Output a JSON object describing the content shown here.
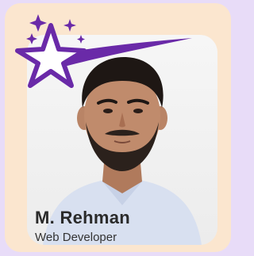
{
  "profile": {
    "name": "M. Rehman",
    "role": "Web Developer"
  },
  "colors": {
    "page_background": "#e8dcf8",
    "card_background": "#fbe6cf",
    "star_purple": "#6a2aa8"
  },
  "icons": [
    "star-icon",
    "sparkle-icon"
  ]
}
